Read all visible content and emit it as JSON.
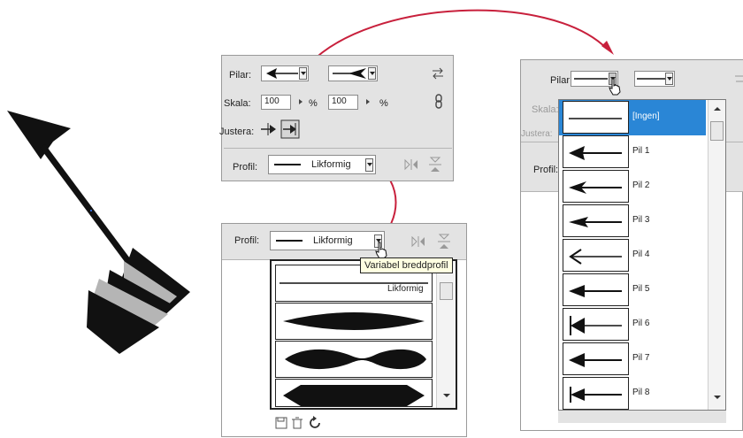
{
  "top_panel": {
    "pilar_label": "Pilar:",
    "skala_label": "Skala:",
    "scale_start": "100",
    "scale_end": "100",
    "percent_1": "%",
    "percent_2": "%",
    "justera_label": "Justera:",
    "profil_label": "Profil:",
    "profile_value": "Likformig"
  },
  "profile_popup": {
    "profil_label": "Profil:",
    "profile_value": "Likformig",
    "tooltip": "Variabel breddprofil",
    "first_item_label": "Likformig"
  },
  "right_panel": {
    "pilar_label": "Pilar:",
    "skala_label": "Skala:",
    "justera_label": "Justera:",
    "profil_label": "Profil:",
    "items": [
      {
        "label": "[Ingen]"
      },
      {
        "label": "Pil 1"
      },
      {
        "label": "Pil 2"
      },
      {
        "label": "Pil 3"
      },
      {
        "label": "Pil 4"
      },
      {
        "label": "Pil 5"
      },
      {
        "label": "Pil 6"
      },
      {
        "label": "Pil 7"
      },
      {
        "label": "Pil 8"
      }
    ]
  },
  "colors": {
    "highlight": "#2a86d6",
    "connector": "#c8203c",
    "tooltip_bg": "#ffffe1"
  }
}
